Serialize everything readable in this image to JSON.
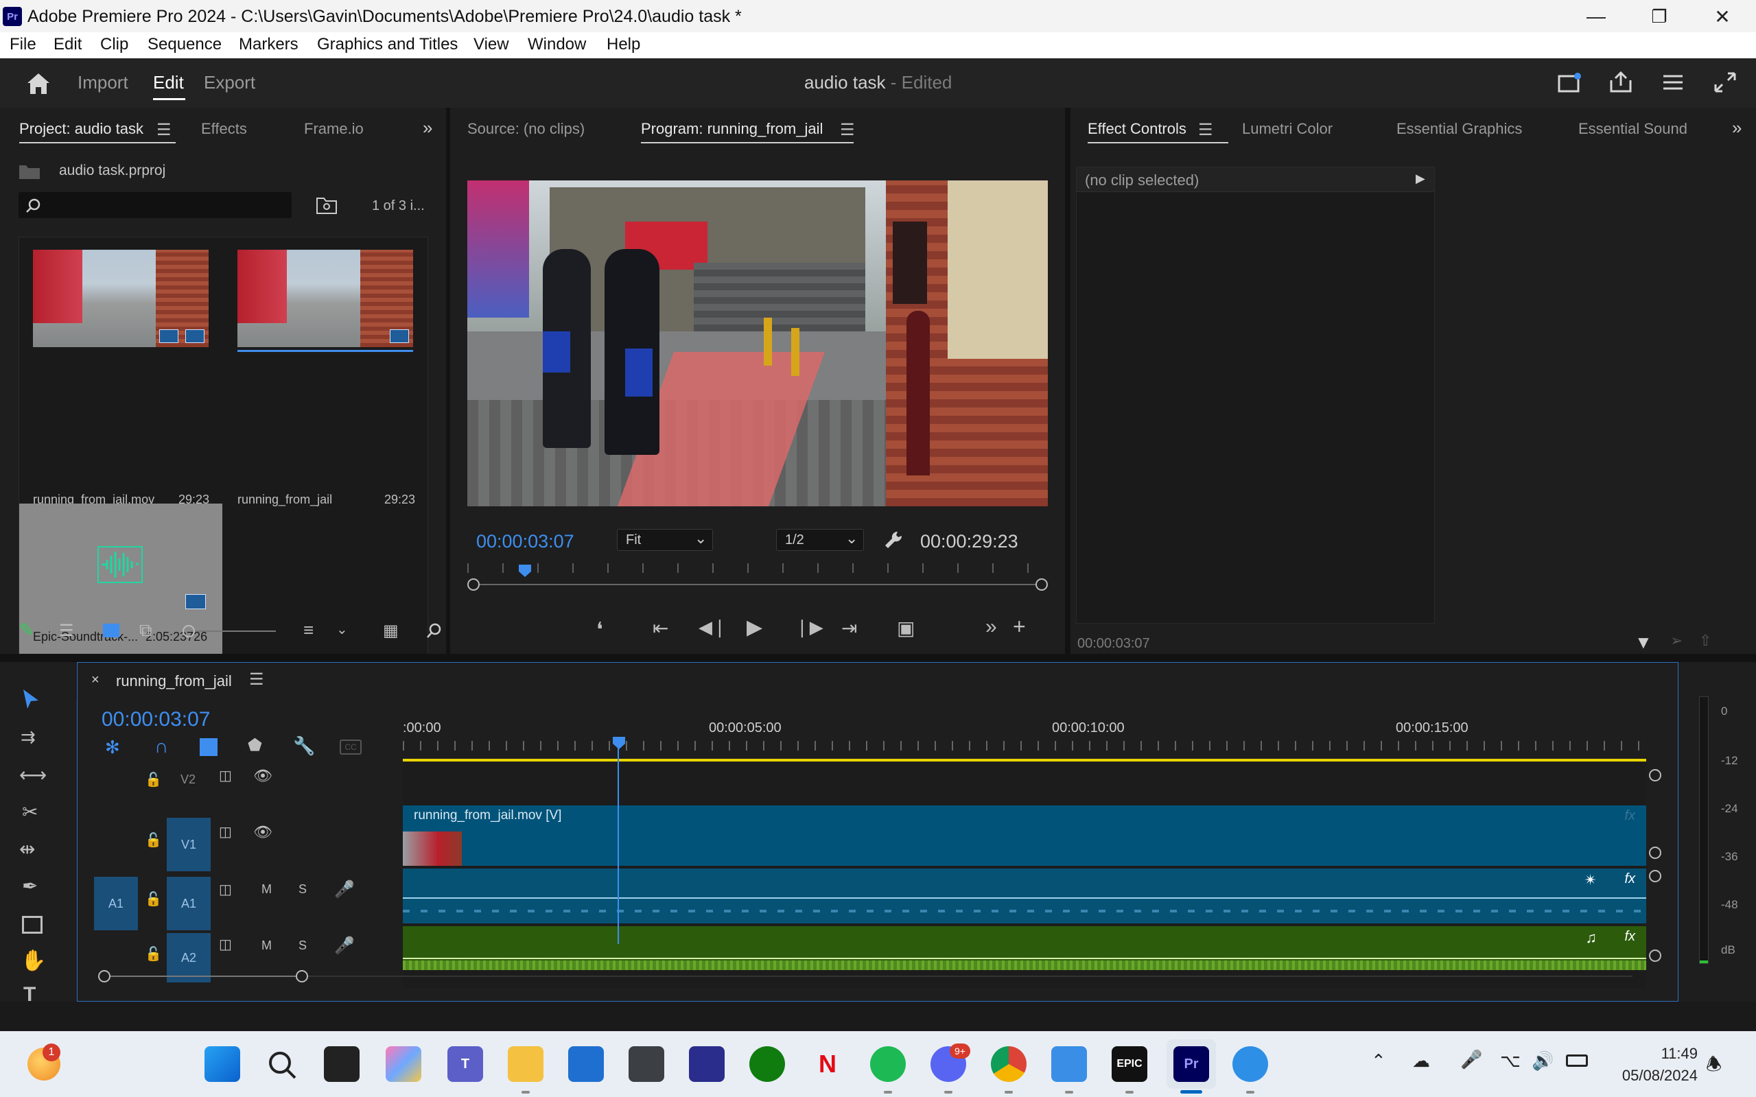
{
  "window": {
    "app_icon": "Pr",
    "title": "Adobe Premiere Pro 2024 - C:\\Users\\Gavin\\Documents\\Adobe\\Premiere Pro\\24.0\\audio task *",
    "minimize": "—",
    "maximize": "❐",
    "close": "✕"
  },
  "menu": [
    "File",
    "Edit",
    "Clip",
    "Sequence",
    "Markers",
    "Graphics and Titles",
    "View",
    "Window",
    "Help"
  ],
  "header": {
    "tabs": [
      "Import",
      "Edit",
      "Export"
    ],
    "active_tab": "Edit",
    "project_name": "audio task",
    "status": " - Edited"
  },
  "project_panel": {
    "tabs": [
      "Project: audio task",
      "Effects",
      "Frame.io"
    ],
    "project_file": "audio task.prproj",
    "search_placeholder": "",
    "count": "1 of 3 i...",
    "items": [
      {
        "name": "running_from_jail.mov",
        "duration": "29:23"
      },
      {
        "name": "running_from_jail",
        "duration": "29:23"
      },
      {
        "name": "Epic-Soundtrack-...",
        "duration": "2:05:23726"
      }
    ]
  },
  "program_monitor": {
    "source_tab": "Source: (no clips)",
    "program_tab": "Program: running_from_jail",
    "timecode": "00:00:03:07",
    "fit": "Fit",
    "resolution": "1/2",
    "duration": "00:00:29:23",
    "playhead_fraction": 0.11
  },
  "effect_controls": {
    "tabs": [
      "Effect Controls",
      "Lumetri Color",
      "Essential Graphics",
      "Essential Sound"
    ],
    "no_clip": "(no clip selected)",
    "timecode": "00:00:03:07"
  },
  "timeline": {
    "sequence_name": "running_from_jail",
    "timecode": "00:00:03:07",
    "ruler": [
      ":00:00",
      "00:00:05:00",
      "00:00:10:00",
      "00:00:15:00"
    ],
    "tracks": [
      {
        "label": "V2"
      },
      {
        "label": "V1"
      },
      {
        "label": "A1",
        "source": "A1"
      },
      {
        "label": "A2"
      }
    ],
    "video_clip": "running_from_jail.mov [V]",
    "fx": "fx",
    "mute": "M",
    "solo": "S",
    "meter_labels": [
      "0",
      "-12",
      "-24",
      "-36",
      "-48",
      "dB"
    ]
  },
  "taskbar": {
    "time": "11:49",
    "date": "05/08/2024",
    "weather_badge": "1",
    "discord_badge": "9+"
  },
  "colors": {
    "accent_blue": "#3e8ef0",
    "video_clip": "#015379",
    "audio1_clip": "#055275",
    "audio2_clip": "#2c5b0c",
    "work_area": "#e8d400"
  }
}
